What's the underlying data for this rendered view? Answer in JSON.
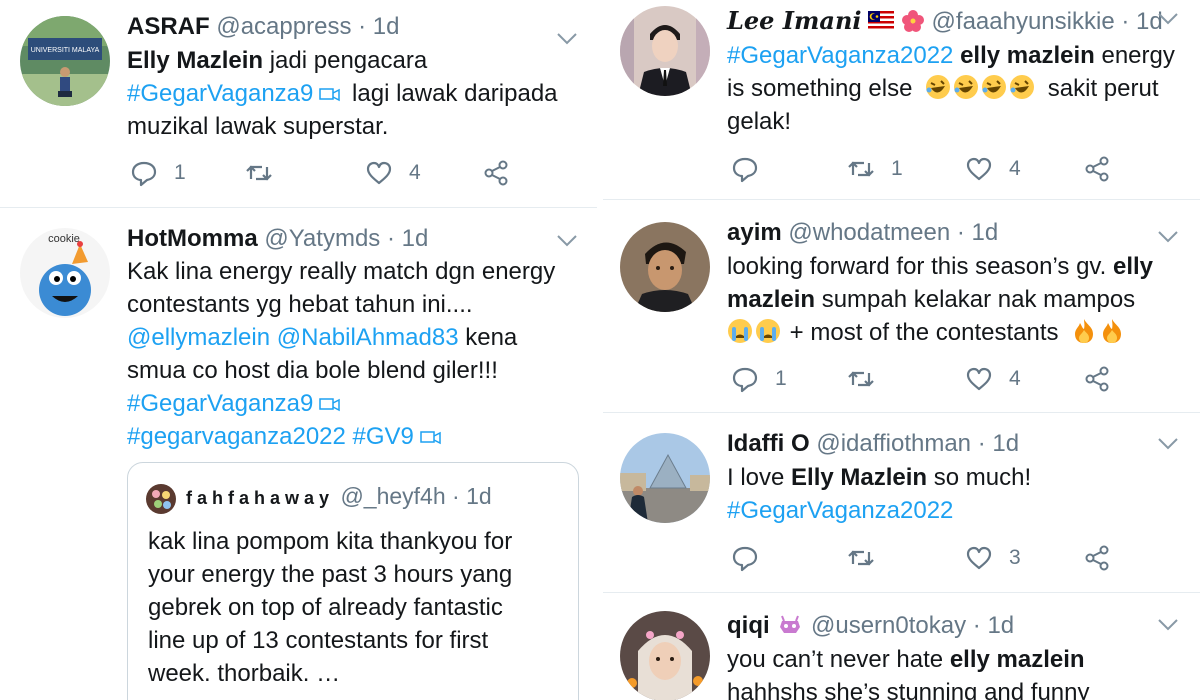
{
  "colors": {
    "link": "#1da1f2",
    "muted": "#657786",
    "text": "#14171a",
    "divider": "#e6ecf0",
    "fire": "#f4900c",
    "cry": "#ffcc4d"
  },
  "left_column": {
    "tweets": [
      {
        "name": "ASRAF",
        "handle": "@acappress",
        "time": "1d",
        "avatar_label": "UNIVERSITI MALAYA",
        "lines": [
          {
            "bold": "Elly Mazlein",
            "rest": " jadi pengacara"
          },
          {
            "link": "#GegarVaganza9",
            "rest": " lagi lawak daripada"
          },
          {
            "plain": "muzikal lawak superstar."
          }
        ],
        "reply_count": "1",
        "retweet_count": "",
        "like_count": "4"
      },
      {
        "name": "HotMomma",
        "handle": "@Yatymds",
        "time": "1d",
        "avatar_label": "cookie",
        "lines": [
          {
            "plain": "Kak lina energy really match dgn energy"
          },
          {
            "plain": "contestants yg hebat tahun ini...."
          },
          {
            "link1": "@ellymazlein",
            "link2": "@NabilAhmad83",
            "rest": " kena"
          },
          {
            "plain": "smua co host dia bole blend giler!!!"
          },
          {
            "link": "#GegarVaganza9"
          },
          {
            "link1": "#gegarvaganza2022",
            "link2": "#GV9"
          }
        ],
        "quote": {
          "name": "fahfahaway",
          "handle": "@_heyf4h",
          "time": "1d",
          "lines": [
            "kak lina pompom kita thankyou for",
            "your energy the past 3 hours yang",
            "gebrek on top of already fantastic",
            "line up of 13 contestants for first",
            "week. thorbaik. …"
          ]
        }
      }
    ]
  },
  "right_column": {
    "tweets": [
      {
        "name": "Lee Imani",
        "handle": "@faaahyunsikkie",
        "time": "1d",
        "lines": [
          {
            "link": "#GegarVaganza2022",
            "bold": "elly mazlein",
            "rest": " energy"
          },
          {
            "plain": "is something else",
            "rest": " sakit perut"
          },
          {
            "plain": "gelak!"
          }
        ],
        "reply_count": "",
        "retweet_count": "1",
        "like_count": "4"
      },
      {
        "name": "ayim",
        "handle": "@whodatmeen",
        "time": "1d",
        "lines": [
          {
            "plain": "looking forward for this season’s gv.",
            "bold": "elly"
          },
          {
            "bold": "mazlein",
            "rest": " sumpah kelakar nak mampos"
          },
          {
            "plain": "+ most of the contestants"
          }
        ],
        "reply_count": "1",
        "retweet_count": "",
        "like_count": "4"
      },
      {
        "name": "Idaffi O",
        "handle": "@idaffiothman",
        "time": "1d",
        "lines": [
          {
            "plain": "I love ",
            "bold": "Elly Mazlein",
            "rest": " so much!"
          },
          {
            "link": "#GegarVaganza2022"
          }
        ],
        "reply_count": "",
        "retweet_count": "",
        "like_count": "3"
      },
      {
        "name": "qiqi",
        "handle": "@usern0tokay",
        "time": "1d",
        "lines": [
          {
            "plain": "you can’t never hate ",
            "bold": "elly mazlein"
          },
          {
            "plain": "hahhshs she’s stunning and funny"
          }
        ]
      }
    ]
  }
}
